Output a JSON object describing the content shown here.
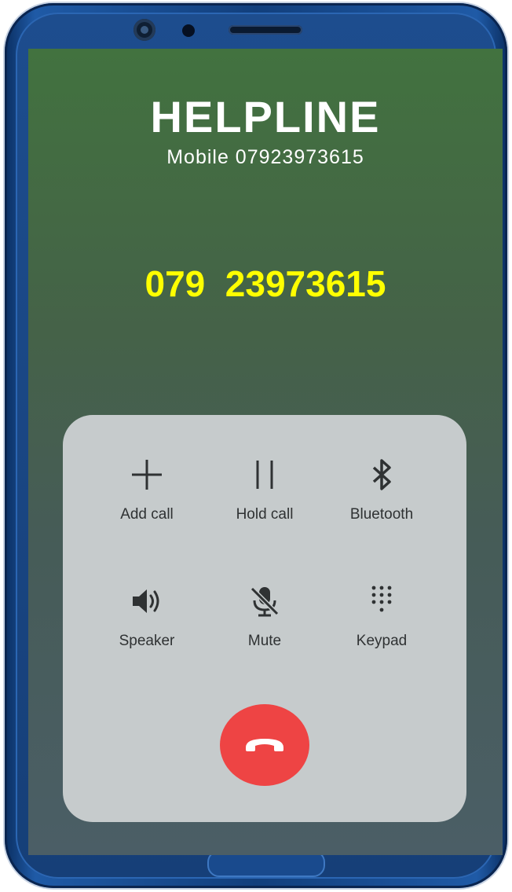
{
  "call": {
    "caller_name": "HELPLINE",
    "subtitle": "Mobile  07923973615",
    "overlay_number": "079  23973615"
  },
  "controls": [
    {
      "label": "Add call",
      "icon": "plus-icon"
    },
    {
      "label": "Hold call",
      "icon": "pause-icon"
    },
    {
      "label": "Bluetooth",
      "icon": "bluetooth-icon"
    },
    {
      "label": "Speaker",
      "icon": "speaker-icon"
    },
    {
      "label": "Mute",
      "icon": "mic-off-icon"
    },
    {
      "label": "Keypad",
      "icon": "keypad-icon"
    }
  ],
  "end_call": {
    "icon": "hang-up-icon"
  },
  "colors": {
    "overlay_number": "#ffff00",
    "end_call": "#ee4444",
    "panel": "#c6cbcc",
    "frame": "#1f5aa6"
  }
}
